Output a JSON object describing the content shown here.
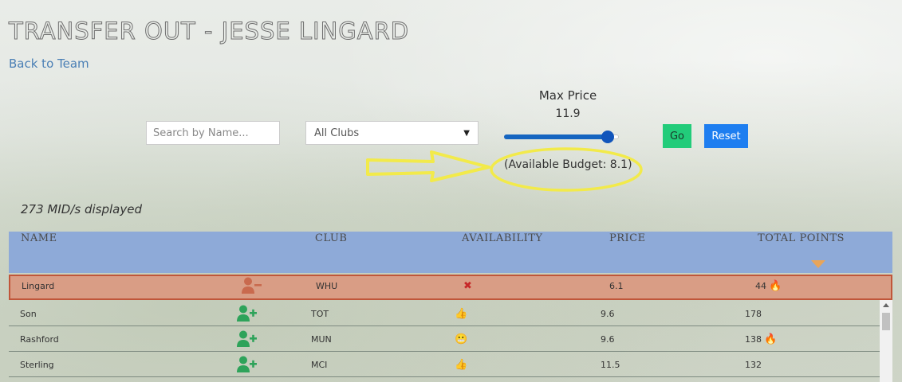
{
  "page": {
    "title": "TRANSFER OUT - JESSE LINGARD",
    "back_link": "Back to Team"
  },
  "filters": {
    "search_placeholder": "Search by Name...",
    "club_selected": "All Clubs",
    "max_price_label": "Max Price",
    "max_price_value": "11.9",
    "max_price_level_percent": 90,
    "go_label": "Go",
    "reset_label": "Reset",
    "budget_text": "(Available Budget: 8.1)"
  },
  "results": {
    "count_text": "273 MID/s displayed"
  },
  "table": {
    "headers": {
      "name": "NAME",
      "club": "CLUB",
      "availability": "AVAILABILITY",
      "price": "PRICE",
      "total_points": "TOTAL POINTS"
    },
    "rows": [
      {
        "name": "Lingard",
        "action_icon": "remove-player-icon",
        "club": "WHU",
        "availability": "✖",
        "availability_icon": "unavailable-icon",
        "price": "6.1",
        "points": "44",
        "hot": true
      },
      {
        "name": "Son",
        "action_icon": "add-player-icon",
        "club": "TOT",
        "availability": "👍",
        "availability_icon": "thumbs-up-icon",
        "price": "9.6",
        "points": "178",
        "hot": false
      },
      {
        "name": "Rashford",
        "action_icon": "add-player-icon",
        "club": "MUN",
        "availability": "😬",
        "availability_icon": "grimace-icon",
        "price": "9.6",
        "points": "138",
        "hot": true
      },
      {
        "name": "Sterling",
        "action_icon": "add-player-icon",
        "club": "MCI",
        "availability": "👍",
        "availability_icon": "thumbs-up-icon",
        "price": "11.5",
        "points": "132",
        "hot": false
      }
    ]
  },
  "colors": {
    "header_bg": "#8eaad8",
    "selected_row_bg": "#d99d85",
    "selected_row_border": "#c0563a",
    "add_icon": "#2ea35a",
    "remove_icon": "#c96a4e",
    "go_button": "#22cc7a",
    "reset_button": "#1e7ef0",
    "annotation": "#f2ea4a"
  },
  "icons": {
    "hot": "🔥"
  }
}
